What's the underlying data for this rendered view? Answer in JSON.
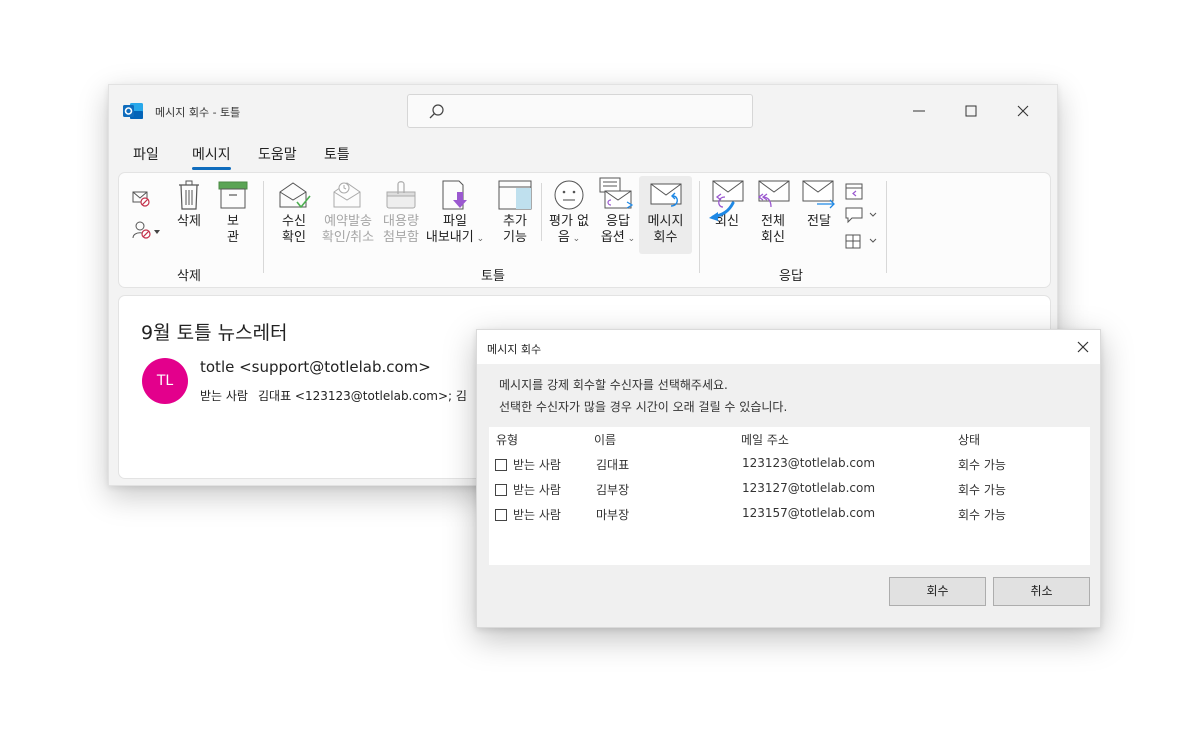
{
  "window": {
    "title": "메시지 회수 - 토틀",
    "menu": [
      "파일",
      "메시지",
      "도움말",
      "토틀"
    ],
    "active_menu": "메시지"
  },
  "ribbon": {
    "delete_group": {
      "delete_line1": "삭제",
      "archive_line1": "보",
      "archive_line2": "관",
      "label": "삭제"
    },
    "totle_group": {
      "read_receipt": [
        "수신",
        "확인"
      ],
      "schedule": [
        "예약발송",
        "확인/취소"
      ],
      "large_attach": [
        "대용량",
        "첨부함"
      ],
      "export": [
        "파일",
        "내보내기"
      ],
      "addins": [
        "추가",
        "기능"
      ],
      "no_rating": [
        "평가 없",
        "음"
      ],
      "reply_opts": [
        "응답",
        "옵션"
      ],
      "recall": [
        "메시지",
        "회수"
      ],
      "label": "토틀"
    },
    "reply_group": {
      "reply": "회신",
      "reply_all": [
        "전체",
        "회신"
      ],
      "forward": "전달",
      "label": "응답"
    }
  },
  "message": {
    "subject": "9월 토틀 뉴스레터",
    "avatar_initials": "TL",
    "sender": "totle <support@totlelab.com>",
    "to_label": "받는 사람",
    "to_value": "김대표 <123123@totlelab.com>; 김"
  },
  "dialog": {
    "title": "메시지 회수",
    "line1": "메시지를 강제 회수할 수신자를 선택해주세요.",
    "line2": "선택한 수신자가 많을 경우 시간이 오래 걸릴 수 있습니다.",
    "columns": [
      "유형",
      "이름",
      "메일 주소",
      "상태"
    ],
    "rows": [
      {
        "type": "받는 사람",
        "name": "김대표",
        "email": "123123@totlelab.com",
        "status": "회수 가능"
      },
      {
        "type": "받는 사람",
        "name": "김부장",
        "email": "123127@totlelab.com",
        "status": "회수 가능"
      },
      {
        "type": "받는 사람",
        "name": "마부장",
        "email": "123157@totlelab.com",
        "status": "회수 가능"
      }
    ],
    "ok": "회수",
    "cancel": "취소"
  },
  "colors": {
    "accent": "#0f6cbd",
    "avatar": "#e3008c",
    "outlook_blue": "#0f6cbd"
  }
}
